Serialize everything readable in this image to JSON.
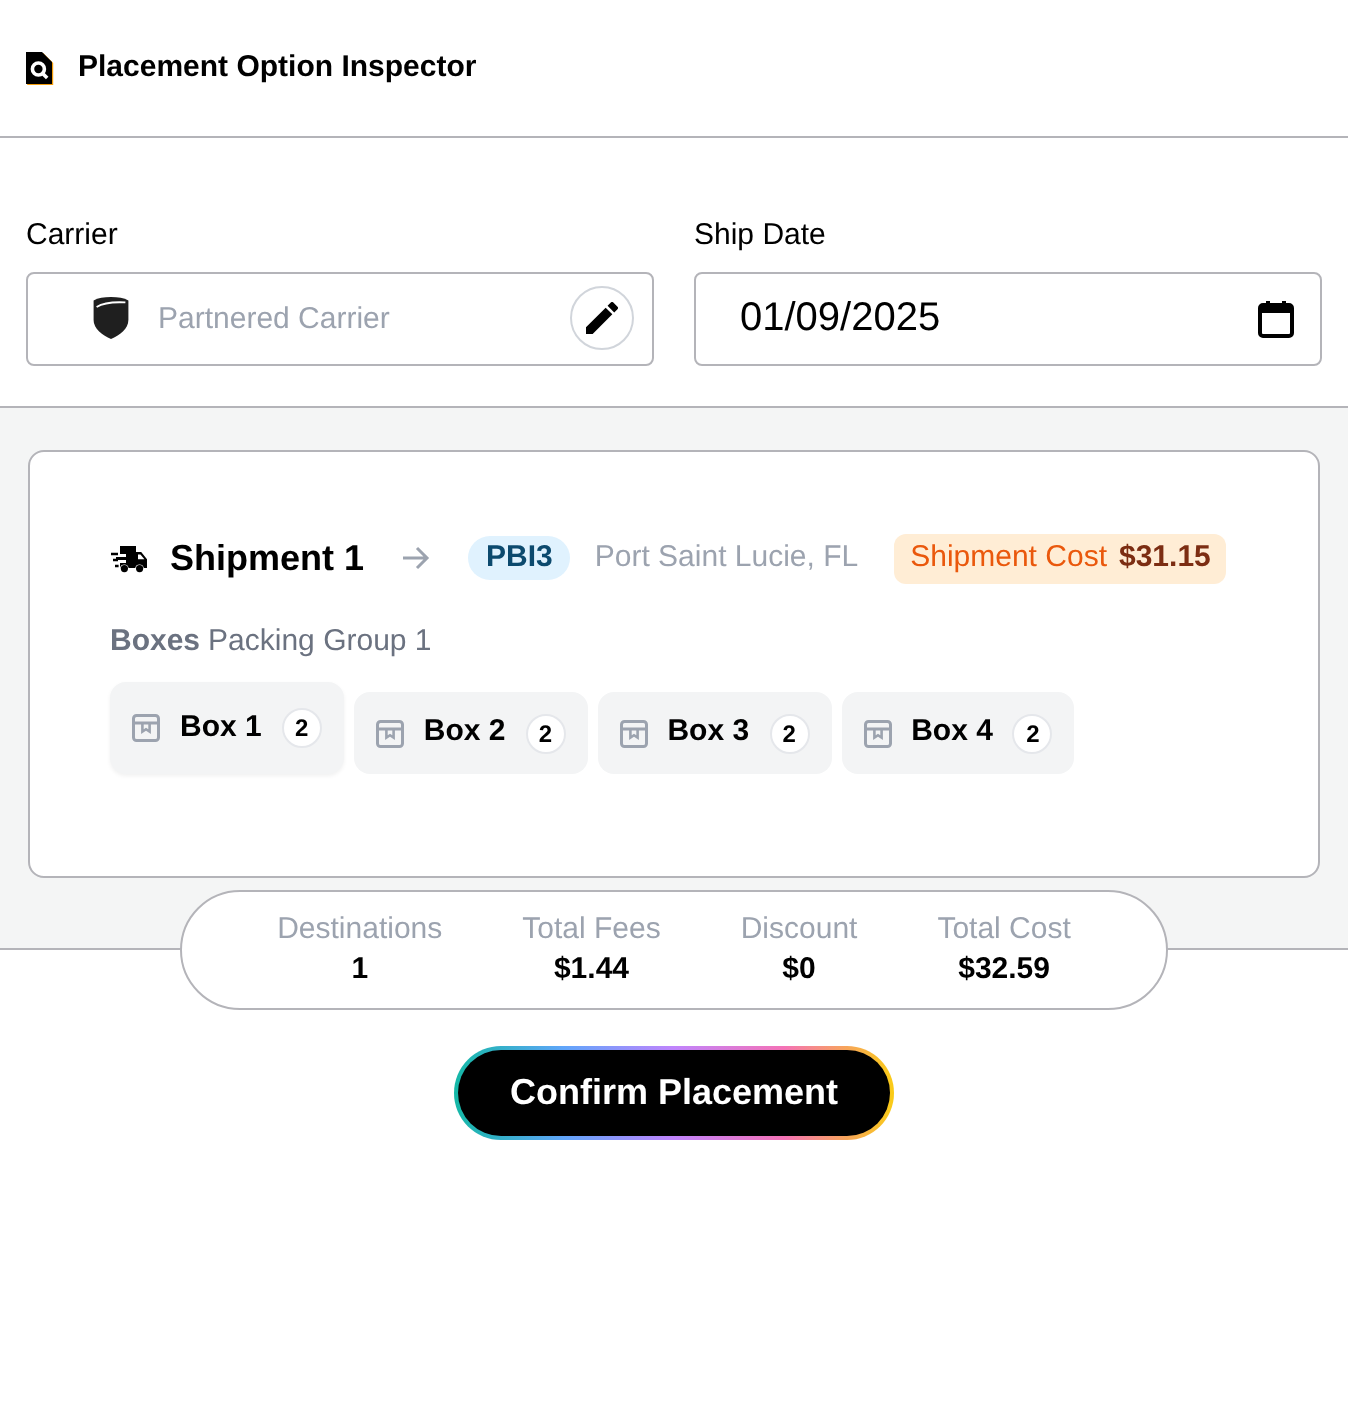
{
  "header": {
    "title": "Placement Option Inspector"
  },
  "carrier": {
    "label": "Carrier",
    "placeholder": "Partnered Carrier"
  },
  "ship_date": {
    "label": "Ship Date",
    "value": "01/09/2025"
  },
  "shipment": {
    "title": "Shipment 1",
    "destination_code": "PBI3",
    "destination_city": "Port Saint Lucie, FL",
    "cost_label": "Shipment Cost",
    "cost_value": "$31.15",
    "boxes_label": "Boxes",
    "packing_group": "Packing Group 1",
    "boxes": [
      {
        "label": "Box 1",
        "count": "2",
        "selected": true
      },
      {
        "label": "Box 2",
        "count": "2",
        "selected": false
      },
      {
        "label": "Box 3",
        "count": "2",
        "selected": false
      },
      {
        "label": "Box 4",
        "count": "2",
        "selected": false
      }
    ]
  },
  "summary": [
    {
      "label": "Destinations",
      "value": "1"
    },
    {
      "label": "Total Fees",
      "value": "$1.44"
    },
    {
      "label": "Discount",
      "value": "$0"
    },
    {
      "label": "Total Cost",
      "value": "$32.59"
    }
  ],
  "confirm_button": {
    "label": "Confirm Placement"
  }
}
